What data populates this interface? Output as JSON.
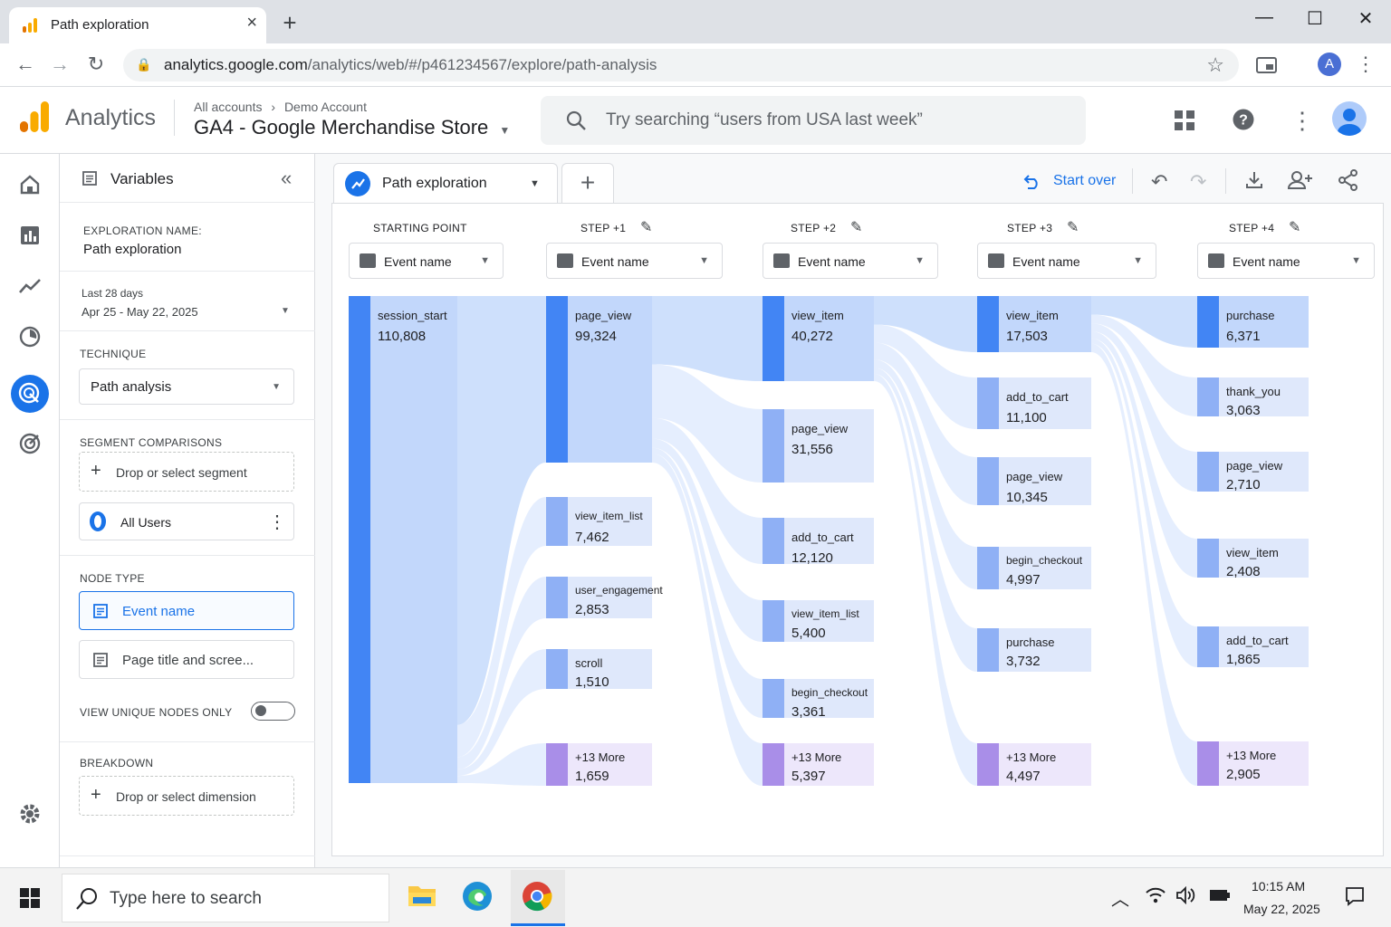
{
  "browser": {
    "tab_title": "Path exploration",
    "url_host": "analytics.google.com",
    "url_path": "/analytics/web/#/p461234567/explore/path-analysis",
    "profile_initial": "A"
  },
  "header": {
    "brand": "Analytics",
    "breadcrumb_all": "All accounts",
    "breadcrumb_account": "Demo Account",
    "property": "GA4 -  Google Merchandise Store",
    "search_placeholder": "Try searching “users from USA last week”"
  },
  "variables": {
    "title": "Variables",
    "exploration_name_label": "EXPLORATION NAME:",
    "exploration_name": "Path exploration",
    "date_label": "Last 28 days",
    "date_range": "Apr 25  -  May 22, 2025",
    "technique_label": "TECHNIQUE",
    "technique": "Path analysis",
    "segment_label": "SEGMENT COMPARISONS",
    "segment_drop": "Drop or select segment",
    "segment_all_users": "All Users",
    "node_type_label": "NODE TYPE",
    "node_type_event": "Event name",
    "node_type_page": "Page title and scree...",
    "unique_nodes_label": "VIEW UNIQUE NODES ONLY",
    "breakdown_label": "BREAKDOWN",
    "breakdown_drop": "Drop or select dimension"
  },
  "toolbar": {
    "tab_label": "Path exploration",
    "start_over": "Start over"
  },
  "steps": [
    {
      "label": "STARTING POINT",
      "select": "Event name"
    },
    {
      "label": "STEP +1",
      "select": "Event name"
    },
    {
      "label": "STEP +2",
      "select": "Event name"
    },
    {
      "label": "STEP +3",
      "select": "Event name"
    },
    {
      "label": "STEP +4",
      "select": "Event name"
    }
  ],
  "nodes": [
    [
      {
        "name": "session_start",
        "value": "110,808",
        "count": 110808
      }
    ],
    [
      {
        "name": "page_view",
        "value": "99,324",
        "count": 99324
      },
      {
        "name": "view_item_list",
        "value": "7,462",
        "count": 7462
      },
      {
        "name": "user_engagement",
        "value": "2,853",
        "count": 2853
      },
      {
        "name": "scroll",
        "value": "1,510",
        "count": 1510
      },
      {
        "name": "+13 More",
        "value": "1,659",
        "count": 1659
      }
    ],
    [
      {
        "name": "view_item",
        "value": "40,272",
        "count": 40272
      },
      {
        "name": "page_view",
        "value": "31,556",
        "count": 31556
      },
      {
        "name": "add_to_cart",
        "value": "12,120",
        "count": 12120
      },
      {
        "name": "view_item_list",
        "value": "5,400",
        "count": 5400
      },
      {
        "name": "begin_checkout",
        "value": "3,361",
        "count": 3361
      },
      {
        "name": "+13 More",
        "value": "5,397",
        "count": 5397
      }
    ],
    [
      {
        "name": "view_item",
        "value": "17,503",
        "count": 17503
      },
      {
        "name": "add_to_cart",
        "value": "11,100",
        "count": 11100
      },
      {
        "name": "page_view",
        "value": "10,345",
        "count": 10345
      },
      {
        "name": "begin_checkout",
        "value": "4,997",
        "count": 4997
      },
      {
        "name": "purchase",
        "value": "3,732",
        "count": 3732
      },
      {
        "name": "+13 More",
        "value": "4,497",
        "count": 4497
      }
    ],
    [
      {
        "name": "purchase",
        "value": "6,371",
        "count": 6371
      },
      {
        "name": "thank_you",
        "value": "3,063",
        "count": 3063
      },
      {
        "name": "page_view",
        "value": "2,710",
        "count": 2710
      },
      {
        "name": "view_item",
        "value": "2,408",
        "count": 2408
      },
      {
        "name": "add_to_cart",
        "value": "1,865",
        "count": 1865
      },
      {
        "name": "+13 More",
        "value": "2,905",
        "count": 2905
      }
    ]
  ],
  "colors": {
    "accent": "#1a73e8",
    "node_strong": "#4285f4",
    "node_light": "#d2e3fc",
    "more_purple": "#a98ee8",
    "flow": "#c6dafc"
  },
  "taskbar": {
    "search_placeholder": "Type here to search",
    "time": "10:15 AM",
    "date": "May 22, 2025"
  }
}
